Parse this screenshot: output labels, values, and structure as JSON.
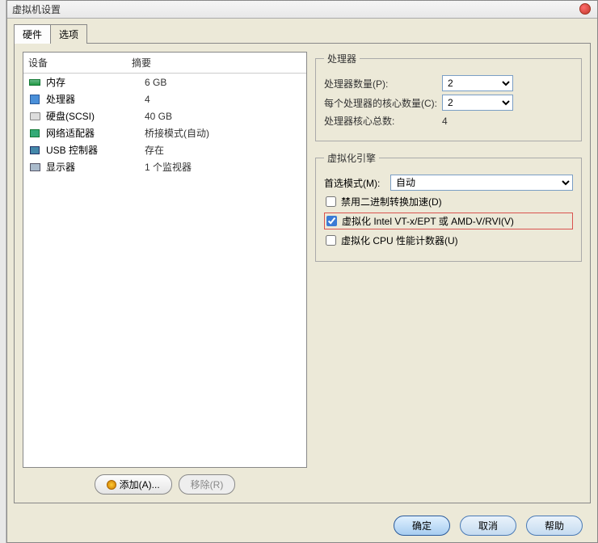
{
  "window": {
    "title": "虚拟机设置"
  },
  "tabs": {
    "hardware": "硬件",
    "options": "选项"
  },
  "device_list": {
    "col_device": "设备",
    "col_summary": "摘要",
    "rows": [
      {
        "name": "内存",
        "summary": "6 GB",
        "icon": "mem"
      },
      {
        "name": "处理器",
        "summary": "4",
        "icon": "cpu",
        "selected": true
      },
      {
        "name": "硬盘(SCSI)",
        "summary": "40 GB",
        "icon": "disk"
      },
      {
        "name": "网络适配器",
        "summary": "桥接模式(自动)",
        "icon": "net"
      },
      {
        "name": "USB 控制器",
        "summary": "存在",
        "icon": "usb"
      },
      {
        "name": "显示器",
        "summary": "1 个监视器",
        "icon": "display"
      }
    ]
  },
  "buttons": {
    "add": "添加(A)...",
    "remove": "移除(R)"
  },
  "processor_group": {
    "legend": "处理器",
    "count_label": "处理器数量(P):",
    "count_value": "2",
    "cores_label": "每个处理器的核心数量(C):",
    "cores_value": "2",
    "total_label": "处理器核心总数:",
    "total_value": "4"
  },
  "virt_group": {
    "legend": "虚拟化引擎",
    "pref_label": "首选模式(M):",
    "pref_value": "自动",
    "chk_disable_bin": "禁用二进制转换加速(D)",
    "chk_vtx": "虚拟化 Intel VT-x/EPT 或 AMD-V/RVI(V)",
    "chk_perf": "虚拟化 CPU 性能计数器(U)"
  },
  "dialog_buttons": {
    "ok": "确定",
    "cancel": "取消",
    "help": "帮助"
  }
}
